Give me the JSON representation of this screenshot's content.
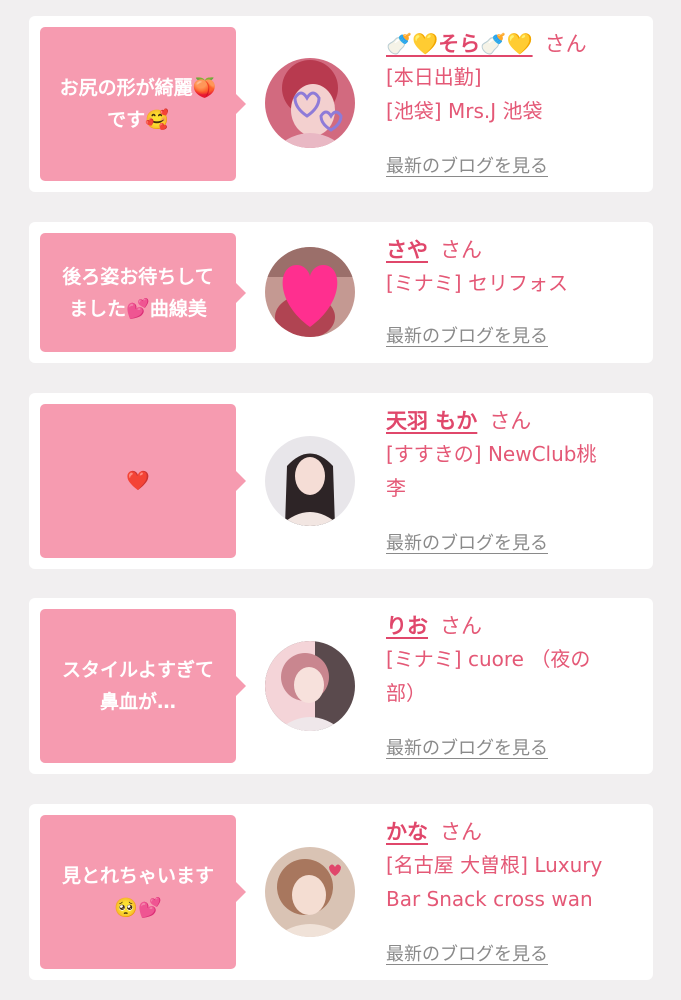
{
  "cards": [
    {
      "comment": "お尻の形が綺麗🍑\nです🥰",
      "name": "🍼💛そら🍼💛",
      "honorific": "さん",
      "lines": [
        "[本日出勤]",
        "[池袋] Mrs.J 池袋"
      ],
      "blog_link": "最新のブログを見る",
      "avatar_colors": [
        "#b83a4f",
        "#e9b8c4",
        "#d26a7f"
      ]
    },
    {
      "comment": "後ろ姿お待ちして\nました💕曲線美",
      "name": "さや",
      "honorific": "さん",
      "lines": [
        "[ミナミ] セリフォス"
      ],
      "blog_link": "最新のブログを見る",
      "avatar_colors": [
        "#9b6f6a",
        "#ff2f8f",
        "#c49992"
      ]
    },
    {
      "comment": "❤️",
      "name": "天羽 もか",
      "honorific": "さん",
      "lines": [
        "[すすきの] NewClub桃",
        "李"
      ],
      "blog_link": "最新のブログを見る",
      "avatar_colors": [
        "#e8e6ea",
        "#2d2426",
        "#f2e6e2"
      ]
    },
    {
      "comment": "スタイルよすぎて\n鼻血が…",
      "name": "りお",
      "honorific": "さん",
      "lines": [
        "[ミナミ] cuore （夜の",
        "部）"
      ],
      "blog_link": "最新のブログを見る",
      "avatar_colors": [
        "#f4d4d8",
        "#c9868f",
        "#5a4a4d"
      ]
    },
    {
      "comment": "見とれちゃいます\n🥺💕",
      "name": "かな",
      "honorific": "さん",
      "lines": [
        "[名古屋 大曽根] Luxury",
        "Bar Snack cross wan"
      ],
      "blog_link": "最新のブログを見る",
      "avatar_colors": [
        "#d9c3b4",
        "#a8775e",
        "#f0e2d8"
      ]
    }
  ],
  "colors": {
    "accent": "#e0476b",
    "bubble": "#f69bb0",
    "background": "#f1eff0"
  }
}
